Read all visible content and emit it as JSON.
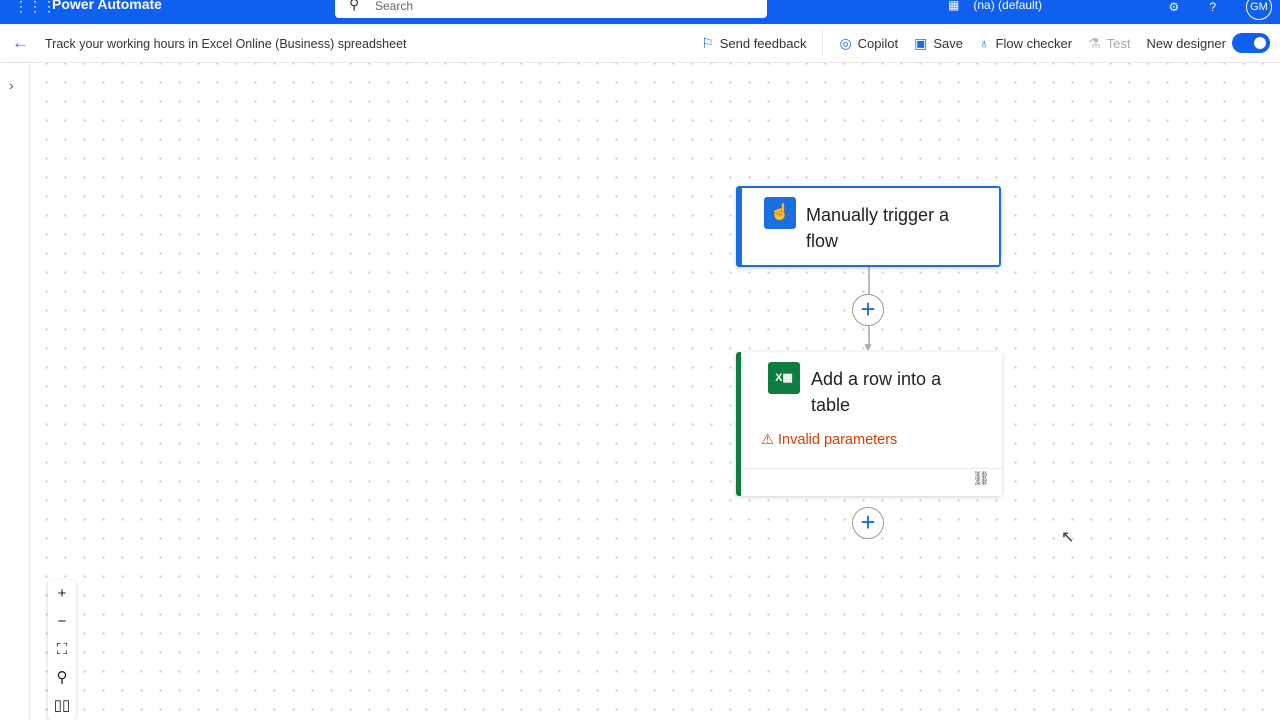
{
  "header": {
    "app_name": "Power Automate",
    "search_placeholder": "Search",
    "environment": "(na) (default)",
    "avatar_initials": "GM"
  },
  "toolbar": {
    "flow_title": "Track your working hours in Excel Online (Business) spreadsheet",
    "send_feedback": "Send feedback",
    "copilot": "Copilot",
    "save": "Save",
    "flow_checker": "Flow checker",
    "test": "Test",
    "new_designer": "New designer",
    "new_designer_on": true
  },
  "flow": {
    "trigger": {
      "title": "Manually trigger a flow"
    },
    "action": {
      "title": "Add a row into a table",
      "error": "Invalid parameters"
    }
  },
  "colors": {
    "brand": "#0f5ff0",
    "accent": "#1a6fe0",
    "excel": "#107c41",
    "error": "#d83b01"
  }
}
